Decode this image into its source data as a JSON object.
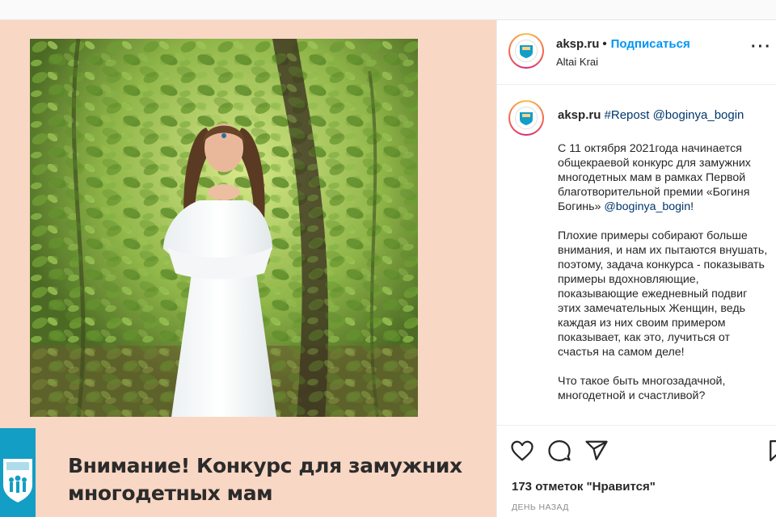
{
  "post": {
    "image": {
      "headline_line1": "Внимание! Конкурс для замужних",
      "headline_line2": "многодетных мам",
      "logo_icon": "org-logo-icon",
      "colors": {
        "background": "#f8d7c4",
        "logo_block": "#139ec5"
      }
    },
    "header": {
      "username": "aksp.ru",
      "separator": "•",
      "follow_label": "Подписаться",
      "location": "Altai Krai",
      "more_icon": "more-options-icon"
    },
    "caption": {
      "username": "aksp.ru",
      "repost_tag": "#Repost",
      "repost_user": "@boginya_bogin",
      "paragraph1": [
        "С 11 октября 2021года начинается",
        "общекраевой конкурс для замужних",
        "многодетных мам в рамках Первой",
        "благотворительной премии «Богиня",
        "Богинь» "
      ],
      "paragraph1_mention": "@boginya_bogin",
      "paragraph1_end": "!",
      "paragraph2": [
        "Плохие примеры собирают больше",
        "внимания, и нам их пытаются внушать,",
        "поэтому, задача конкурса - показывать",
        "примеры вдохновляющие,",
        "показывающие ежедневный подвиг",
        "этих замечательных Женщин, ведь",
        "каждая из них своим примером",
        "показывает, как это, лучиться от",
        "счастья на самом деле!"
      ],
      "paragraph3": [
        "Что такое быть многозадачной,",
        "многодетной и счастливой?"
      ]
    },
    "actions": {
      "like_icon": "heart-icon",
      "comment_icon": "comment-icon",
      "share_icon": "share-icon",
      "save_icon": "bookmark-icon",
      "likes_text": "173 отметок \"Нравится\"",
      "time_ago": "день назад"
    },
    "colors": {
      "link": "#0095f6",
      "mention": "#00376b",
      "muted": "#8e8e8e"
    }
  }
}
